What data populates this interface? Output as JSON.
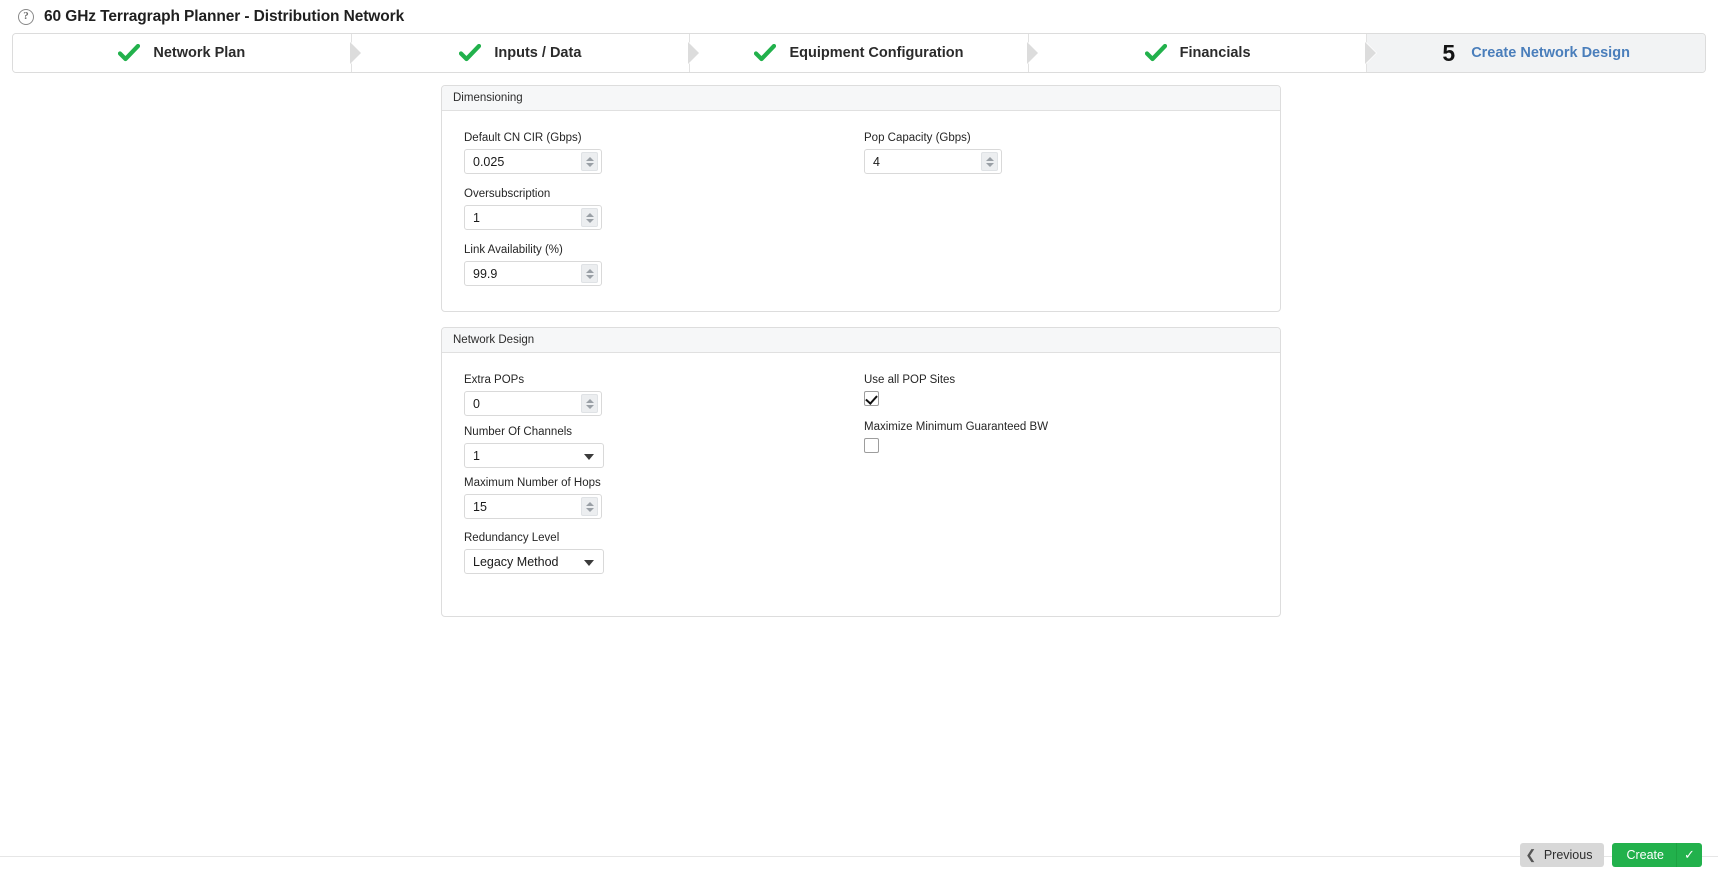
{
  "titlebar": {
    "help_icon": "help-question-icon",
    "title": "60 GHz Terragraph Planner - Distribution Network"
  },
  "wizard": {
    "steps": [
      {
        "label": "Network Plan",
        "state": "complete",
        "icon": "green-check-icon"
      },
      {
        "label": "Inputs / Data",
        "state": "complete",
        "icon": "green-check-icon"
      },
      {
        "label": "Equipment Configuration",
        "state": "complete",
        "icon": "green-check-icon"
      },
      {
        "label": "Financials",
        "state": "complete",
        "icon": "green-check-icon"
      },
      {
        "label": "Create Network Design",
        "state": "active",
        "number": "5"
      }
    ]
  },
  "panels": {
    "dimensioning": {
      "header": "Dimensioning",
      "fields": {
        "default_cn_cir": {
          "label": "Default CN CIR (Gbps)",
          "value": "0.025"
        },
        "pop_capacity": {
          "label": "Pop Capacity (Gbps)",
          "value": "4"
        },
        "oversubscription": {
          "label": "Oversubscription",
          "value": "1"
        },
        "link_availability": {
          "label": "Link Availability (%)",
          "value": "99.9"
        }
      }
    },
    "network_design": {
      "header": "Network Design",
      "fields": {
        "extra_pops": {
          "label": "Extra POPs",
          "value": "0"
        },
        "use_all_pop_sites": {
          "label": "Use all POP Sites",
          "checked": true
        },
        "number_of_channels": {
          "label": "Number Of Channels",
          "value": "1"
        },
        "maximize_min_bw": {
          "label": "Maximize Minimum Guaranteed BW",
          "checked": false
        },
        "max_number_of_hops": {
          "label": "Maximum Number of Hops",
          "value": "15"
        },
        "redundancy_level": {
          "label": "Redundancy Level",
          "value": "Legacy Method"
        }
      }
    }
  },
  "footer": {
    "previous_label": "Previous",
    "previous_icon": "chevron-left-icon",
    "create_label": "Create",
    "create_icon": "check-icon"
  },
  "colors": {
    "accent_green": "#22b14c",
    "active_step_text": "#4a7ebb",
    "panel_header_bg": "#f6f7f8",
    "active_step_bg": "#f2f3f4"
  }
}
